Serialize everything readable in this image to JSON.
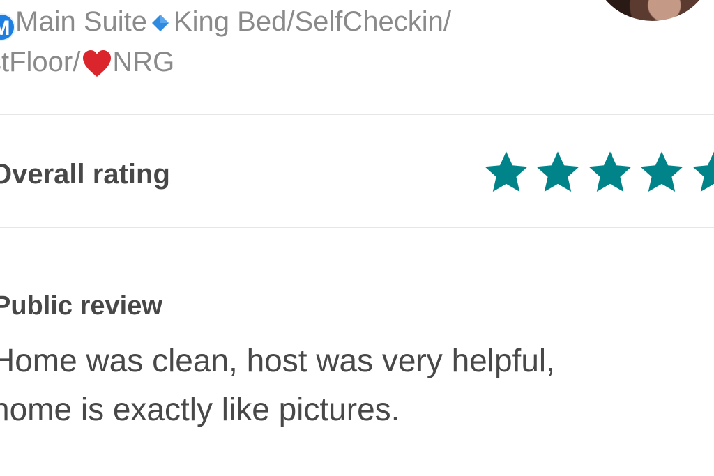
{
  "listing": {
    "title_line1_badge": "M",
    "title_line1_part1": "Main Suite",
    "title_line1_part2": "King Bed/SelfCheckin/",
    "title_line2_part1": "stFloor/",
    "title_line2_part2": "NRG"
  },
  "rating": {
    "label": "Overall rating",
    "stars_shown": 5,
    "star_color": "#008489"
  },
  "review": {
    "label": "Public review",
    "text_line1": "Home was clean, host was very helpful,",
    "text_line2": "home is exactly like pictures."
  },
  "colors": {
    "title_text": "#8a8a8a",
    "body_text": "#484848",
    "divider": "#e6e6e6",
    "badge_blue": "#1d7fe2",
    "diamond_blue": "#2e8be0",
    "heart_red": "#d9252b"
  },
  "icons": {
    "badge": "circled-m-icon",
    "diamond": "blue-diamond-icon",
    "heart": "red-heart-icon",
    "star": "star-icon"
  }
}
